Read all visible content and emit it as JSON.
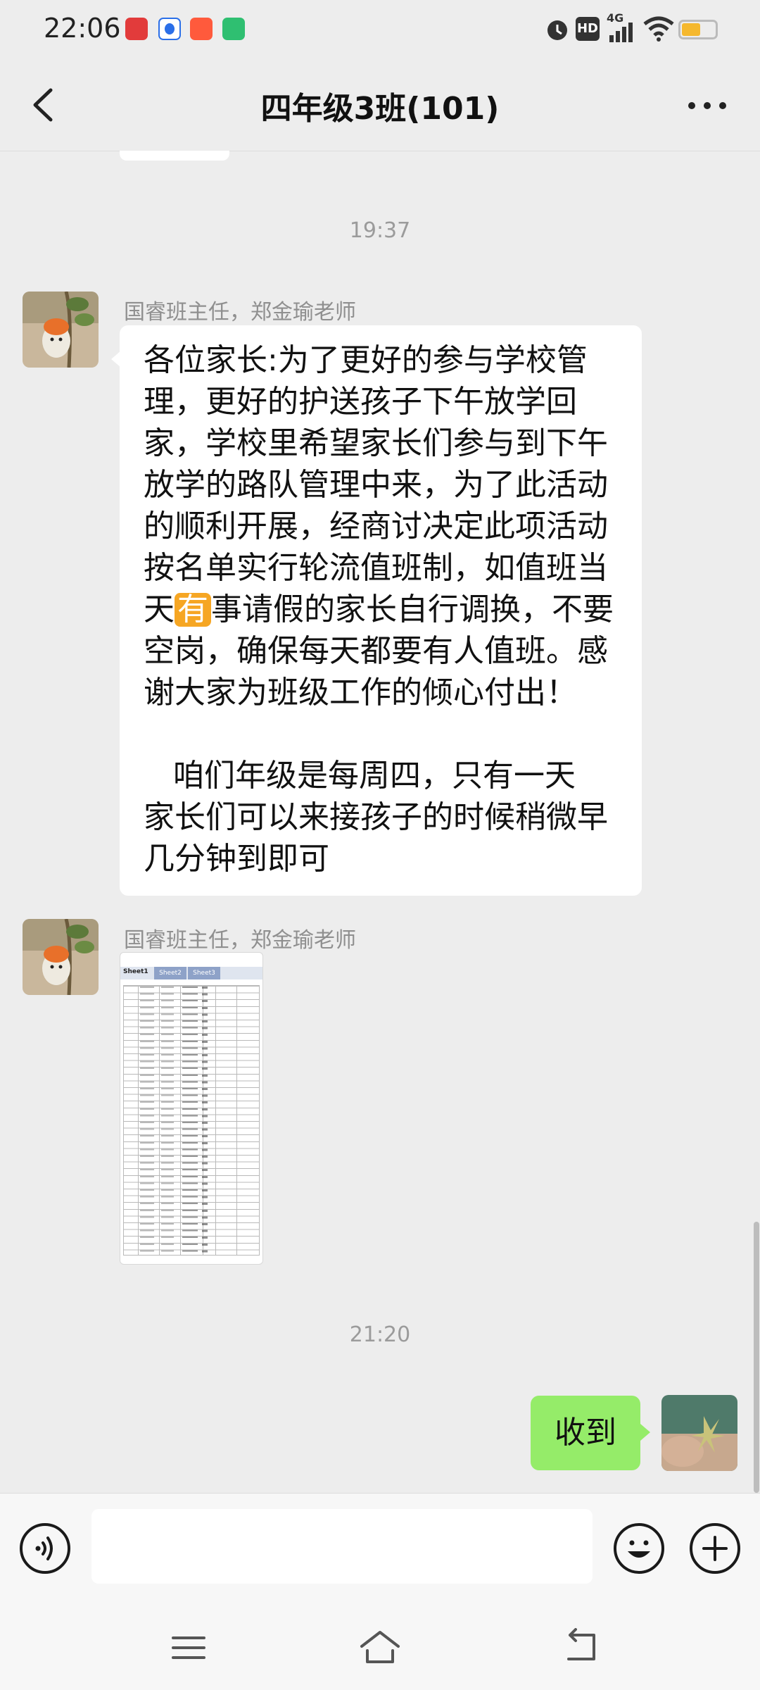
{
  "status_bar": {
    "time": "22:06",
    "app_icons": [
      {
        "name": "app-icon-1",
        "color": "#e23b3b"
      },
      {
        "name": "app-icon-baidu",
        "color": "#2b6fe8"
      },
      {
        "name": "app-icon-3",
        "color": "#ff5a3c"
      },
      {
        "name": "app-icon-iqiyi",
        "color": "#2fbf71"
      }
    ],
    "network": "4G",
    "hd_badge": "HD",
    "battery_color": "#f5b82e"
  },
  "header": {
    "title": "四年级3班(101)",
    "back_icon": "chevron-left-icon",
    "more_icon": "more-dots-icon"
  },
  "chat": {
    "time_separators": [
      "19:37",
      "21:20"
    ],
    "messages": [
      {
        "sender": "国睿班主任，郑金瑜老师",
        "text_lines": [
          "各位家长:为了更好的参与学校管",
          "理，更好的护送孩子下午放学回",
          "家，学校里希望家长们参与到下午",
          "放学的路队管理中来，为了此活动",
          "的顺利开展，经商讨决定此项活动",
          "按名单实行轮流值班制，如值班当",
          "天",
          "有",
          "事请假的家长自行调换，不要",
          "空岗，确保每天都要有人值班。感",
          "谢大家为班级工作的倾心付出！",
          "",
          "   咱们年级是每周四，只有一天",
          "家长们可以来接孩子的时候稍微早",
          "几分钟到即可"
        ]
      },
      {
        "sender": "国睿班主任，郑金瑜老师",
        "attachment": {
          "type": "spreadsheet-image",
          "tabs": [
            "Sheet1",
            "Sheet2",
            "Sheet3"
          ]
        }
      },
      {
        "sender": "me",
        "text": "收到"
      }
    ]
  },
  "input_bar": {
    "voice_icon": "voice-icon",
    "emoji_icon": "emoji-icon",
    "plus_icon": "plus-icon",
    "input_value": ""
  },
  "nav_bar": {
    "menu_icon": "menu-icon",
    "home_icon": "home-icon",
    "back_icon": "back-icon"
  }
}
